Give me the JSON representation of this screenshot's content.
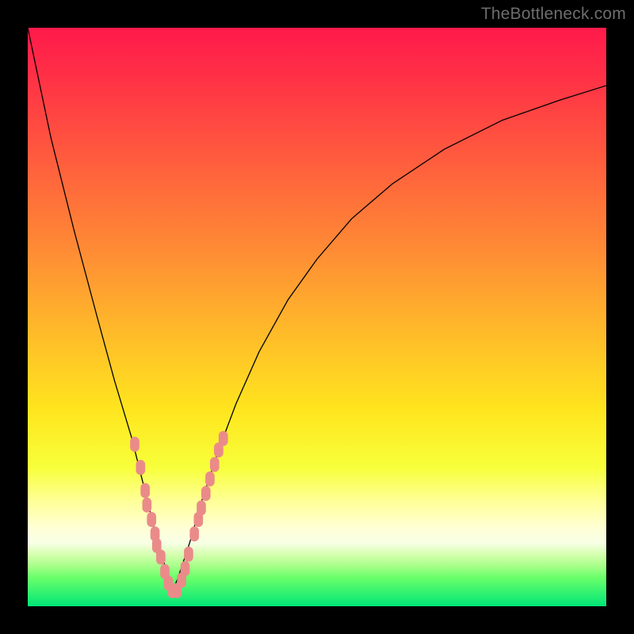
{
  "watermark": "TheBottleneck.com",
  "colors": {
    "frame": "#000000",
    "curve": "#000000",
    "marker": "#ea8b8a",
    "gradient_top": "#ff1a4b",
    "gradient_bottom": "#00e676"
  },
  "chart_data": {
    "type": "line",
    "title": "",
    "xlabel": "",
    "ylabel": "",
    "xlim": [
      0,
      100
    ],
    "ylim": [
      0,
      100
    ],
    "note": "Axes unlabeled; values are approximate percentages of plot width/height. y measured from top (0) to bottom (100). Curve resembles bottleneck V-shape with minimum near x≈25.",
    "series": [
      {
        "name": "bottleneck-curve",
        "x": [
          0,
          4,
          8,
          12,
          15,
          18,
          20,
          22,
          24,
          25,
          26,
          28,
          30,
          33,
          36,
          40,
          45,
          50,
          56,
          63,
          72,
          82,
          92,
          100
        ],
        "y": [
          0,
          19,
          35,
          50,
          61,
          71,
          79,
          87,
          94,
          97.5,
          95,
          89,
          82,
          73,
          65,
          56,
          47,
          40,
          33,
          27,
          21,
          16,
          12.5,
          10
        ]
      }
    ],
    "markers": {
      "name": "highlight-points",
      "note": "Salmon rounded markers clustered near the valley of the curve on both sides.",
      "points": [
        {
          "x": 18.5,
          "y": 72
        },
        {
          "x": 19.5,
          "y": 76
        },
        {
          "x": 20.3,
          "y": 80
        },
        {
          "x": 20.6,
          "y": 82.5
        },
        {
          "x": 21.4,
          "y": 85
        },
        {
          "x": 22.0,
          "y": 87.5
        },
        {
          "x": 22.3,
          "y": 89.5
        },
        {
          "x": 23.0,
          "y": 91.5
        },
        {
          "x": 23.7,
          "y": 94
        },
        {
          "x": 24.3,
          "y": 96
        },
        {
          "x": 25.0,
          "y": 97.3
        },
        {
          "x": 25.8,
          "y": 97.3
        },
        {
          "x": 26.6,
          "y": 95.5
        },
        {
          "x": 27.2,
          "y": 93.5
        },
        {
          "x": 27.8,
          "y": 91
        },
        {
          "x": 28.8,
          "y": 87.5
        },
        {
          "x": 29.5,
          "y": 85
        },
        {
          "x": 30.0,
          "y": 83
        },
        {
          "x": 30.8,
          "y": 80.5
        },
        {
          "x": 31.5,
          "y": 78
        },
        {
          "x": 32.3,
          "y": 75.5
        },
        {
          "x": 33.0,
          "y": 73
        },
        {
          "x": 33.8,
          "y": 71
        }
      ]
    }
  }
}
